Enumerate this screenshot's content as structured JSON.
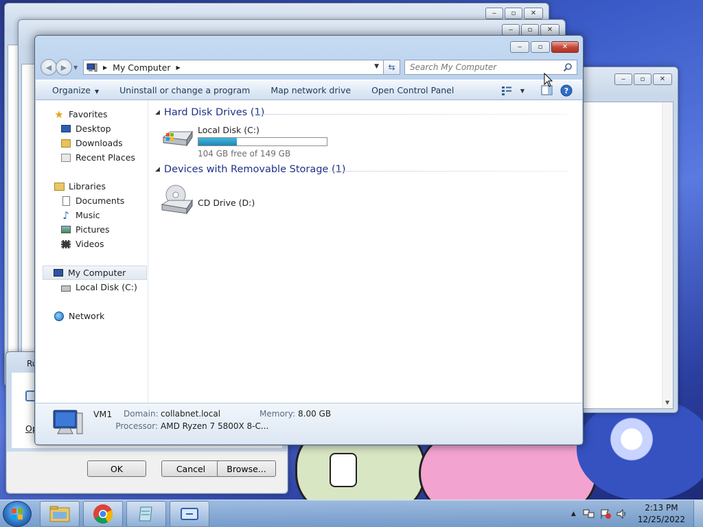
{
  "explorer": {
    "address": {
      "crumb": "My Computer"
    },
    "search": {
      "placeholder": "Search My Computer"
    },
    "commands": {
      "organize": "Organize",
      "uninstall": "Uninstall or change a program",
      "map_drive": "Map network drive",
      "control_panel": "Open Control Panel"
    },
    "nav": {
      "favorites": "Favorites",
      "desktop": "Desktop",
      "downloads": "Downloads",
      "recent": "Recent Places",
      "libraries": "Libraries",
      "documents": "Documents",
      "music": "Music",
      "pictures": "Pictures",
      "videos": "Videos",
      "my_computer": "My Computer",
      "local_disk": "Local Disk (C:)",
      "network": "Network"
    },
    "groups": {
      "hdd": "Hard Disk Drives (1)",
      "removable": "Devices with Removable Storage (1)"
    },
    "drives": {
      "c_label": "Local Disk (C:)",
      "c_free": "104 GB free of 149 GB",
      "c_used_fraction": 0.302,
      "d_label": "CD Drive (D:)"
    },
    "details": {
      "name": "VM1",
      "domain_label": "Domain:",
      "domain": "collabnet.local",
      "memory_label": "Memory:",
      "memory": "8.00 GB",
      "processor_label": "Processor:",
      "processor": "AMD Ryzen 7 5800X 8-C..."
    }
  },
  "run_dialog": {
    "title_partial": "Ru",
    "open_partial": "Ope",
    "ok": "OK",
    "cancel": "Cancel",
    "browse": "Browse..."
  },
  "taskbar": {
    "time": "2:13 PM",
    "date": "12/25/2022"
  },
  "colors": {
    "accent": "#1e3287",
    "close": "#c7483a",
    "bar_fill": "#2a9fd0"
  }
}
